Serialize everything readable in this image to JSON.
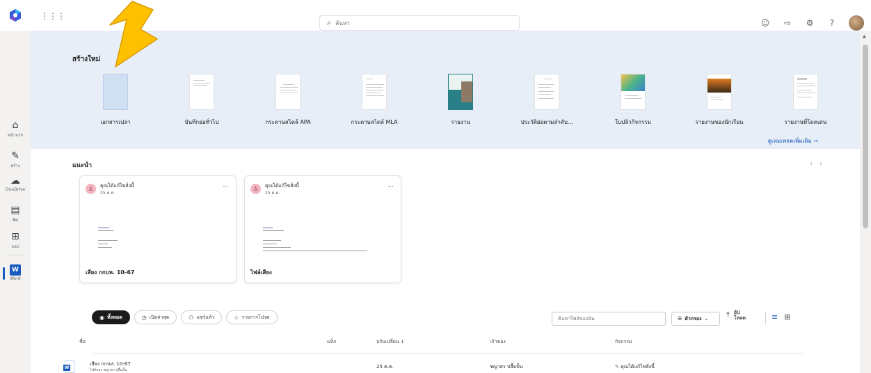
{
  "header": {
    "search_placeholder": "ค้นหา",
    "icons": [
      "emoji-icon",
      "feedback-icon",
      "settings-icon",
      "help-icon",
      "avatar"
    ]
  },
  "rail": {
    "items": [
      {
        "label": "หน้าแรก",
        "icon": "home-icon"
      },
      {
        "label": "สร้าง",
        "icon": "create-icon"
      },
      {
        "label": "OneDrive",
        "icon": "cloud-icon"
      },
      {
        "label": "ฟีด",
        "icon": "feed-icon"
      },
      {
        "label": "แอป",
        "icon": "apps-icon"
      },
      {
        "label": "Word",
        "icon": "word-icon"
      }
    ]
  },
  "create": {
    "title": "สร้างใหม่",
    "templates": [
      {
        "label": "เอกสารเปล่า"
      },
      {
        "label": "บันทึกย่อทั่วไป"
      },
      {
        "label": "กระดาษสไตล์ APA"
      },
      {
        "label": "กระดาษสไตล์ MLA"
      },
      {
        "label": "รายงาน"
      },
      {
        "label": "ประวัติย่อตามลำดับ..."
      },
      {
        "label": "ใบปลิวกิจกรรม"
      },
      {
        "label": "รายงานของนักเรียน"
      },
      {
        "label": "รายงานที่โดดเด่น"
      }
    ],
    "more_link": "ดูเทมเพลตเพิ่มเติม →"
  },
  "recommended": {
    "title": "แนะนำ",
    "cards": [
      {
        "activity": "คุณได้แก้ไขสิ่งนี้",
        "date": "25 ต.ค.",
        "title": "เสียง กกบห. 10-67"
      },
      {
        "activity": "คุณได้แก้ไขสิ่งนี้",
        "date": "25 ต.ค.",
        "title": "ไฟล์เสียง"
      }
    ]
  },
  "filters": {
    "pills": [
      {
        "label": "ทั้งหมด",
        "icon": "all-icon",
        "active": true
      },
      {
        "label": "เปิดล่าสุด",
        "icon": "clock-icon",
        "active": false
      },
      {
        "label": "แชร์แล้ว",
        "icon": "people-icon",
        "active": false
      },
      {
        "label": "รายการโปรด",
        "icon": "star-icon",
        "active": false
      }
    ],
    "search_placeholder": "ค้นหาไฟล์ของฉัน",
    "filter_label": "ตัวกรอง",
    "upload_label_1": "อัป",
    "upload_label_2": "โหลด"
  },
  "table": {
    "columns": [
      "ชื่อ",
      "แท็ก",
      "ปรับเปลี่ยน ↓",
      "เจ้าของ",
      "กิจกรรม"
    ],
    "rows": [
      {
        "name": "เสียง กกบห. 10-67",
        "location": "ไฟล์ของ ชญาธร ปลื้มปั้น",
        "tag": "",
        "modified": "25 ต.ค.",
        "owner": "ชญาธร ปลื้มปั้น",
        "activity": "คุณได้แก้ไขสิ่งนี้"
      }
    ]
  },
  "colors": {
    "brand_blue": "#185abd",
    "create_band": "#e7eef7",
    "arrow_yellow": "#ffc000"
  }
}
